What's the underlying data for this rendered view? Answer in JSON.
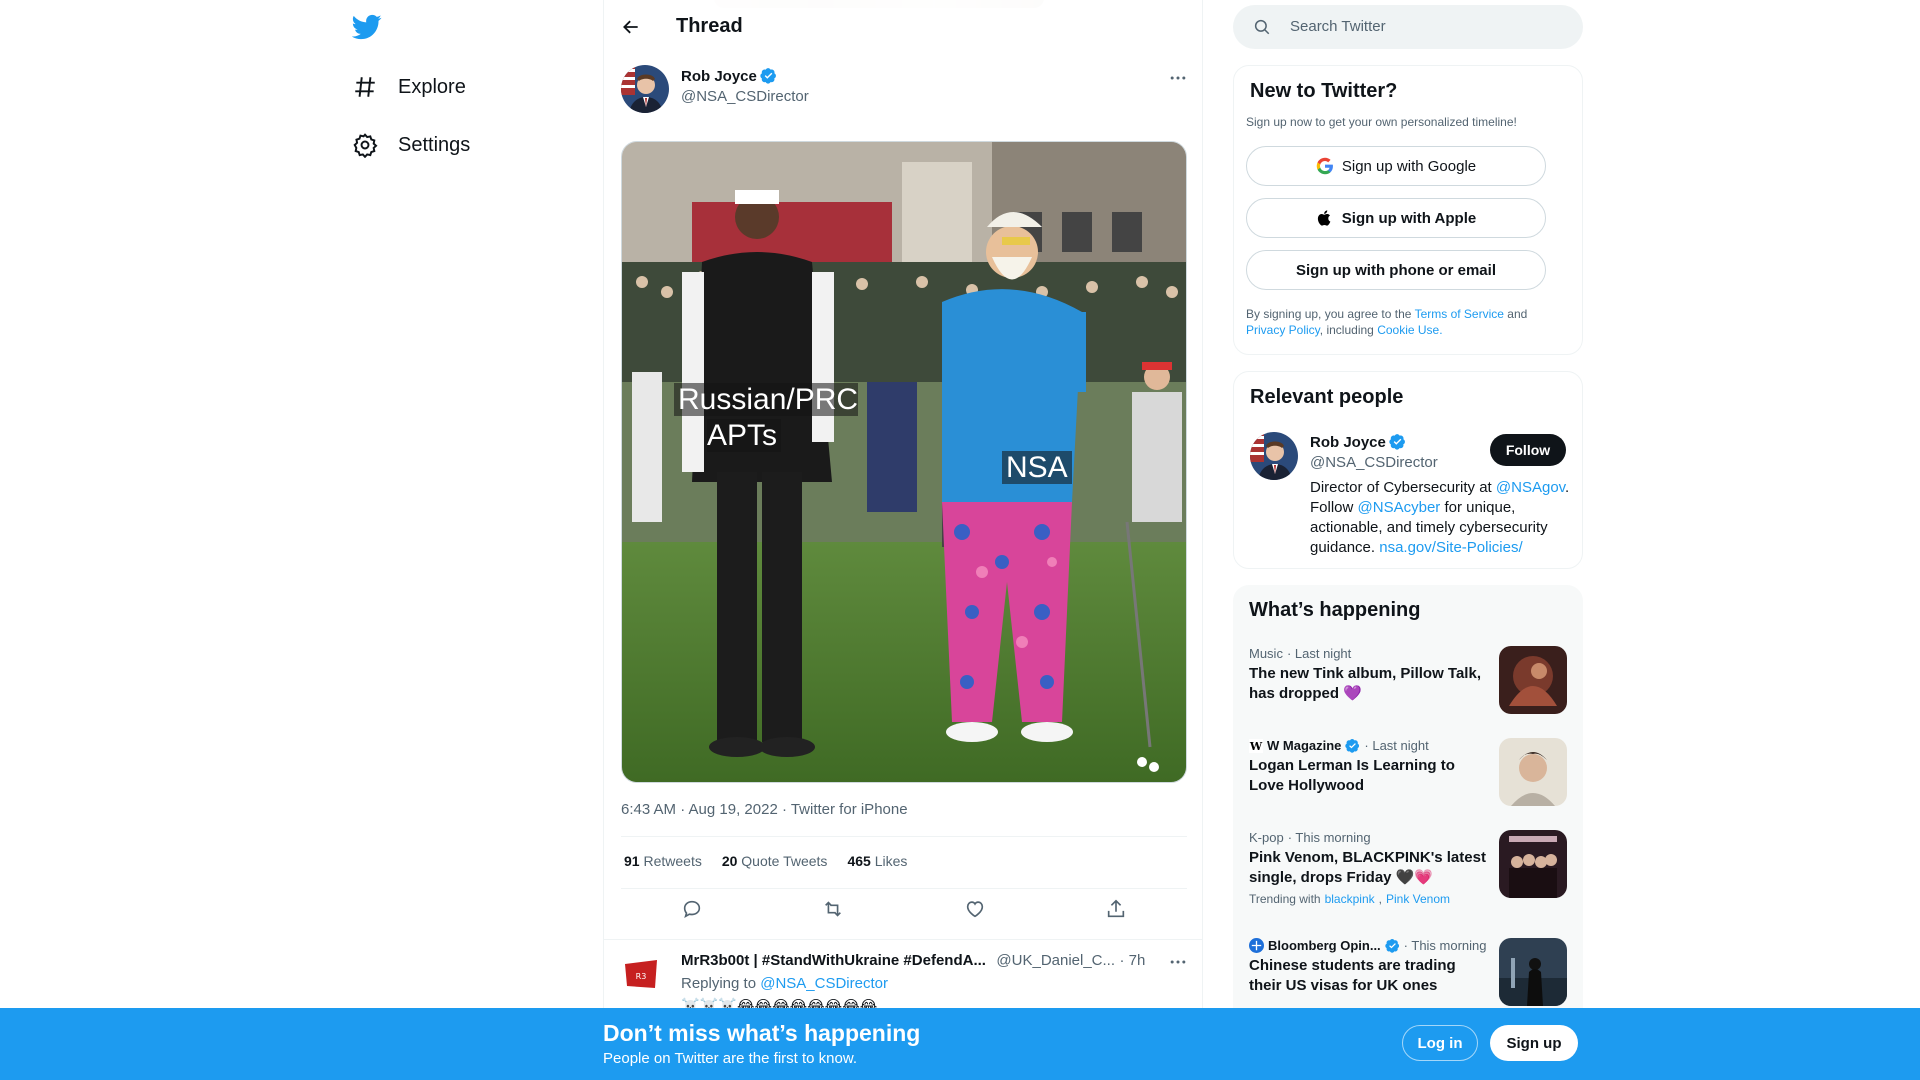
{
  "nav": {
    "items": [
      {
        "label": "Explore",
        "icon": "hashtag-icon"
      },
      {
        "label": "Settings",
        "icon": "gear-icon"
      }
    ]
  },
  "header": {
    "title": "Thread"
  },
  "tweet": {
    "author_name": "Rob Joyce",
    "author_handle": "@NSA_CSDirector",
    "image_label_left": "Russian/PRC\nAPTs",
    "image_label_right": "NSA",
    "timestamp": "6:43 AM · Aug 19, 2022 · Twitter for iPhone",
    "stats": {
      "retweets": "91",
      "retweets_label": "Retweets",
      "quotes": "20",
      "quotes_label": "Quote Tweets",
      "likes": "465",
      "likes_label": "Likes"
    }
  },
  "reply": {
    "name": "MrR3b00t | #StandWithUkraine #DefendA...",
    "handle": "@UK_Daniel_C...",
    "time": "· 7h",
    "replying_prefix": "Replying to",
    "replying_to": "@NSA_CSDirector",
    "text": "☠️☠️☠️😂😂😂😂😂😂😂😂"
  },
  "search": {
    "placeholder": "Search Twitter"
  },
  "new_to_twitter": {
    "title": "New to Twitter?",
    "subtitle": "Sign up now to get your own personalized timeline!",
    "google": "Sign up with Google",
    "apple": "Sign up with Apple",
    "phone": "Sign up with phone or email",
    "terms_prefix": "By signing up, you agree to the",
    "terms_link": "Terms of Service",
    "terms_and": "and",
    "privacy_link": "Privacy Policy",
    "including": ", including",
    "cookie_link": "Cookie Use."
  },
  "relevant": {
    "title": "Relevant people",
    "name": "Rob Joyce",
    "handle": "@NSA_CSDirector",
    "follow": "Follow",
    "bio_1": "Director of Cybersecurity at",
    "bio_link1": "@NSAgov",
    "bio_2": ". Follow",
    "bio_link2": "@NSAcyber",
    "bio_3": "for unique, actionable, and timely cybersecurity guidance.",
    "bio_link3": "nsa.gov/Site-Policies/"
  },
  "happening": {
    "title": "What’s happening",
    "items": [
      {
        "category": "Music",
        "time": "· Last night",
        "headline": "The new Tink album, Pillow Talk, has dropped 💜"
      },
      {
        "source": "W Magazine",
        "time": "· Last night",
        "headline": "Logan Lerman Is Learning to Love Hollywood"
      },
      {
        "category": "K-pop",
        "time": "· This morning",
        "headline": "Pink Venom, BLACKPINK's latest single, drops Friday 🖤💗",
        "trending_prefix": "Trending with",
        "trending_1": "blackpink",
        "trending_2": "Pink Venom"
      },
      {
        "source": "Bloomberg Opin...",
        "time": "· This morning",
        "headline": "Chinese students are trading their US visas for UK ones"
      }
    ]
  },
  "bottom_bar": {
    "title": "Don’t miss what’s happening",
    "subtitle": "People on Twitter are the first to know.",
    "login": "Log in",
    "signup": "Sign up"
  },
  "colors": {
    "accent": "#1d9bf0",
    "text": "#0f1419",
    "muted": "#536471"
  }
}
